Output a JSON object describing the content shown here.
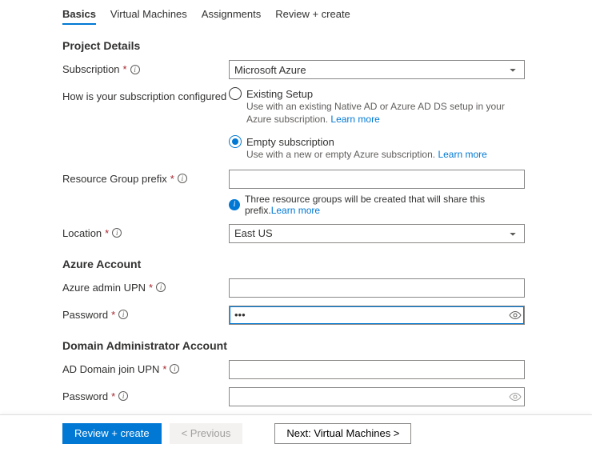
{
  "tabs": {
    "basics": "Basics",
    "vm": "Virtual Machines",
    "assignments": "Assignments",
    "review": "Review + create"
  },
  "sections": {
    "project": "Project Details",
    "azure_account": "Azure Account",
    "domain_admin": "Domain Administrator Account"
  },
  "labels": {
    "subscription": "Subscription",
    "how_configured": "How is your subscription configured",
    "rg_prefix": "Resource Group prefix",
    "location": "Location",
    "admin_upn": "Azure admin UPN",
    "password": "Password",
    "ad_join_upn": "AD Domain join UPN",
    "password2": "Password"
  },
  "fields": {
    "subscription_value": "Microsoft Azure",
    "location_value": "East US",
    "password_value": "•••",
    "rg_info": "Three resource groups will be created that will share this prefix.",
    "learn_more": "Learn more"
  },
  "radios": {
    "existing": {
      "title": "Existing Setup",
      "desc": "Use with an existing Native AD or Azure AD DS setup in your Azure subscription."
    },
    "empty": {
      "title": "Empty subscription",
      "desc": "Use with a new or empty Azure subscription."
    }
  },
  "footer": {
    "review": "Review + create",
    "previous": "< Previous",
    "next": "Next: Virtual Machines >"
  }
}
